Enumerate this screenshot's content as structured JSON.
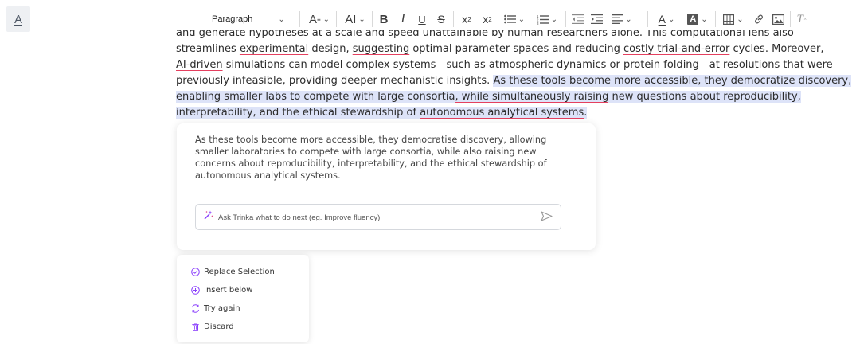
{
  "sidebar": {
    "text_color_label": "A"
  },
  "toolbar": {
    "block_format": "Paragraph",
    "font_size_icon_label": "A",
    "case_label": "AI",
    "bold_label": "B",
    "italic_label": "I",
    "underline_label": "U",
    "strike_label": "S",
    "subscript_label": "x",
    "subscript_sub": "2",
    "superscript_label": "x",
    "superscript_sup": "2",
    "font_color_label": "A",
    "highlight_label": "A",
    "clear_format_label": "T"
  },
  "document": {
    "line0": "and generate hypotheses at a scale and speed unattainable by human researchers alone. This computational lens also",
    "line1": {
      "a": "streamlines ",
      "b": "experimental",
      "c": " design, ",
      "d": "suggesting",
      "e": " optimal parameter spaces and reducing ",
      "f": "costly trial-and-error",
      "g": " cycles. Moreover,"
    },
    "line2": {
      "a": "AI-driven",
      "b": " simulations can model complex systems—such as atmospheric dynamics or protein folding—at resolutions that were"
    },
    "line3": {
      "a": "previously infeasible, providing deeper mechanistic insights. ",
      "b": "As these tools become more accessible, they democratize discovery,"
    },
    "line4": {
      "a": "enabling smaller labs to compete with large consortia",
      "b": ", while simultaneously raising",
      "c": " new questions about reproducibility,"
    },
    "line5": {
      "a": "interpretability, and the ethical stewardship of ",
      "b": "autonomous analytical systems",
      "c": "."
    }
  },
  "suggestion": {
    "text": "As these tools become more accessible, they democratise discovery, allowing smaller laboratories to compete with large consortia, while also raising new concerns about reproducibility, interpretability, and the ethical stewardship of autonomous analytical systems.",
    "ask_placeholder": "Ask Trinka what to do next (eg. Improve fluency)"
  },
  "actions": [
    {
      "label": "Replace Selection",
      "icon": "check-circle-icon"
    },
    {
      "label": "Insert below",
      "icon": "plus-circle-icon"
    },
    {
      "label": "Try again",
      "icon": "refresh-icon"
    },
    {
      "label": "Discard",
      "icon": "trash-icon"
    }
  ],
  "colors": {
    "selection": "#dde3f8",
    "spell_underline": "#e4405f",
    "accent": "#8a3ffc"
  }
}
